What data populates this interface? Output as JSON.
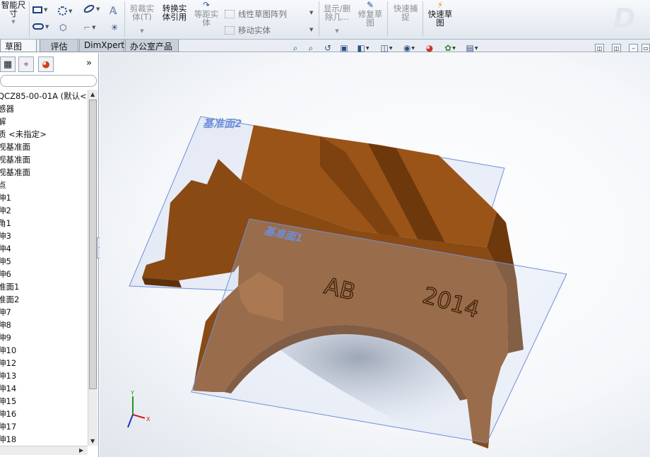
{
  "ribbon": {
    "smart_dim_line1": "智能尺",
    "smart_dim_line2": "寸",
    "trim_line1": "剪裁实",
    "trim_line2": "体(T)",
    "convert_line1": "转换实",
    "convert_line2": "体引用",
    "offset_line1": "等距实",
    "offset_line2": "体",
    "linear_pattern": "线性草图阵列",
    "move_entities": "移动实体",
    "show_delete_line1": "显示/删",
    "show_delete_line2": "除几...",
    "repair_line1": "修复草",
    "repair_line2": "图",
    "quick_snap_line1": "快速捕",
    "quick_snap_line2": "捉",
    "rapid_sketch_line1": "快速草",
    "rapid_sketch_line2": "图"
  },
  "tabs": [
    "草图",
    "评估",
    "DimXpert",
    "办公室产品"
  ],
  "feature_tree": {
    "collapse_glyph": "»",
    "items": [
      "QCZ85-00-01A  (默认<<",
      "感器",
      "解",
      "质 <未指定>",
      "视基准面",
      "视基准面",
      "视基准面",
      "点",
      "伸1",
      "伸2",
      "角1",
      "伸3",
      "伸4",
      "伸5",
      "伸6",
      "准面1",
      "准面2",
      "伸7",
      "伸8",
      "伸9",
      "伸10",
      "伸12",
      "伸13",
      "伸14",
      "伸15",
      "伸16",
      "伸17",
      "伸18"
    ]
  },
  "viewport": {
    "plane1_label": "基准面1",
    "plane2_label": "基准面2",
    "engraving_left": "AB",
    "engraving_right": "2014",
    "triad_x": "X",
    "triad_y": "Y",
    "part_color": "#8a4a14",
    "plane_color": "#6f8fd8"
  }
}
